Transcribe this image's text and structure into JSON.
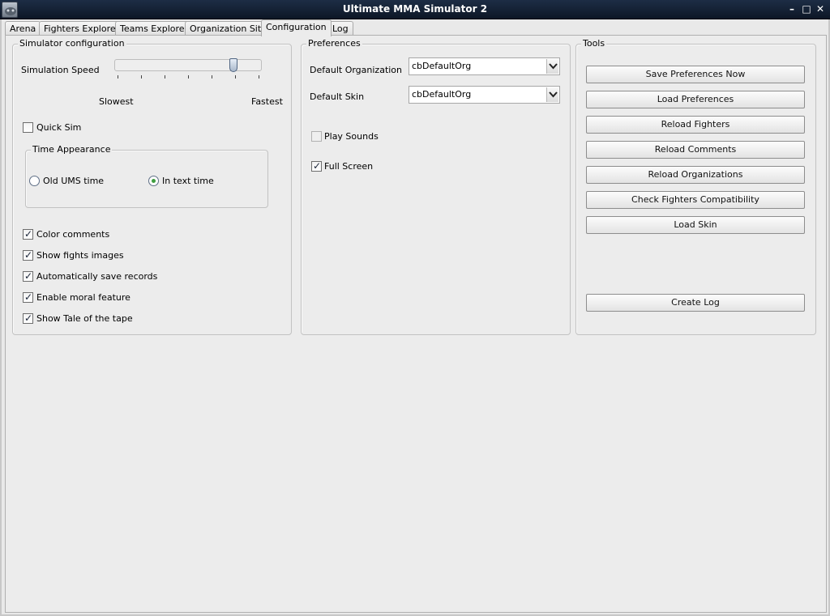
{
  "window": {
    "title": "Ultimate MMA Simulator 2"
  },
  "tabs": [
    "Arena",
    "Fighters Explorer",
    "Teams Explorer",
    "Organization Site",
    "Configuration",
    "Log"
  ],
  "active_tab": "Configuration",
  "simulator": {
    "title": "Simulator configuration",
    "speed_label": "Simulation Speed",
    "slowest": "Slowest",
    "fastest": "Fastest",
    "speed_level_fraction": 0.83,
    "quick_sim": {
      "label": "Quick Sim",
      "checked": false
    },
    "time_appearance": {
      "title": "Time Appearance",
      "old_label": "Old UMS time",
      "text_label": "In text time",
      "selected": "In text time"
    },
    "checks": [
      {
        "label": "Color comments",
        "checked": true
      },
      {
        "label": "Show fights images",
        "checked": true
      },
      {
        "label": "Automatically save records",
        "checked": true
      },
      {
        "label": "Enable moral feature",
        "checked": true
      },
      {
        "label": "Show Tale of the tape",
        "checked": true
      }
    ]
  },
  "preferences": {
    "title": "Preferences",
    "org_label": "Default Organization",
    "org_value": "cbDefaultOrg",
    "skin_label": "Default Skin",
    "skin_value": "cbDefaultOrg",
    "play_sounds": {
      "label": "Play Sounds",
      "checked": false,
      "enabled": false
    },
    "full_screen": {
      "label": "Full Screen",
      "checked": true
    }
  },
  "tools": {
    "title": "Tools",
    "buttons": [
      "Save Preferences Now",
      "Load Preferences",
      "Reload Fighters",
      "Reload Comments",
      "Reload Organizations",
      "Check Fighters Compatibility",
      "Load Skin",
      "Create Log"
    ]
  },
  "icons": {
    "app": "fighter-helmet-icon",
    "minimize": "minimize-icon",
    "maximize": "maximize-icon",
    "close": "close-icon",
    "combo_arrow": "chevron-down-icon"
  },
  "colors": {
    "titlebar": "#132036",
    "radio_dot": "#3f9e3f"
  }
}
